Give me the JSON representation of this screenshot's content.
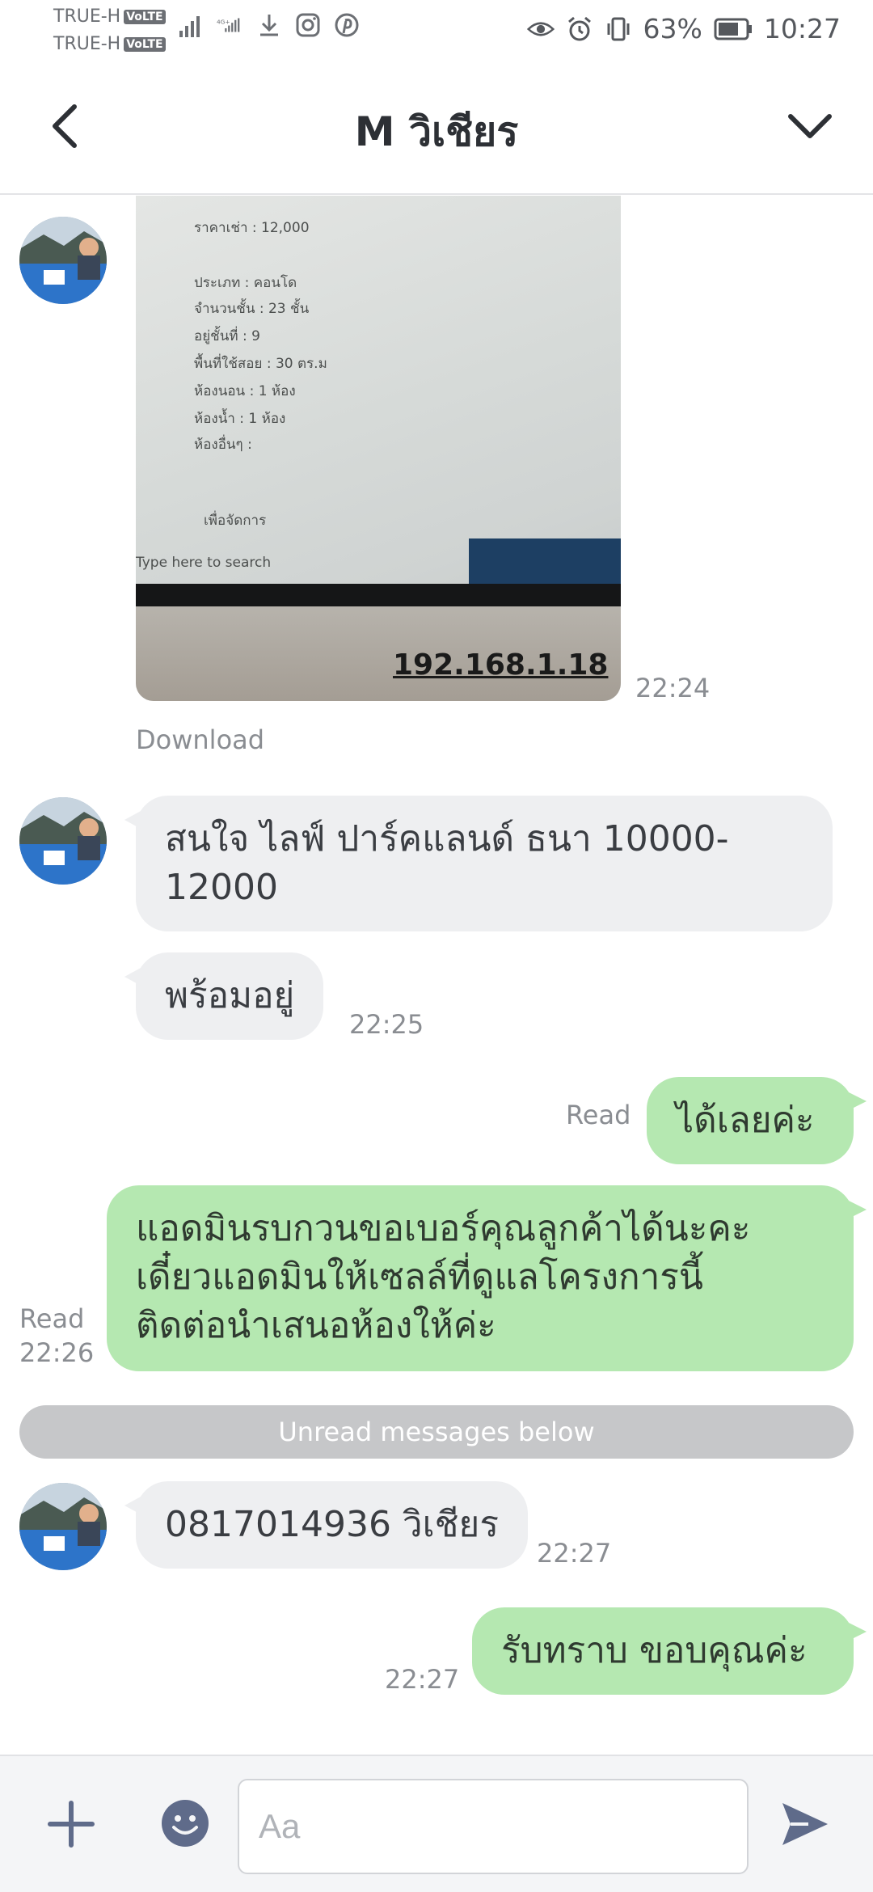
{
  "status_bar": {
    "carrier_1": "TRUE-H",
    "carrier_2": "TRUE-H",
    "volte": "VoLTE",
    "network": "4G+",
    "battery": "63%",
    "time": "10:27",
    "icons": [
      "signal-icon",
      "download-icon",
      "instagram-icon",
      "pinterest-icon",
      "eye-icon",
      "alarm-icon",
      "vibrate-icon",
      "battery-icon"
    ]
  },
  "header": {
    "title": "M วิเชียร"
  },
  "photo": {
    "lines": [
      "ราคาเช่า : 12,000",
      "ประเภท : คอนโด",
      "จำนวนชั้น : 23 ชั้น",
      "อยู่ชั้นที่ : 9",
      "พื้นที่ใช้สอย : 30 ตร.ม",
      "ห้องนอน : 1 ห้อง",
      "ห้องน้ำ : 1 ห้อง",
      "ห้องอื่นๆ :",
      "เพื่อจัดการ",
      "Type here to search"
    ],
    "ip": "192.168.1.18",
    "time": "22:24",
    "download": "Download"
  },
  "messages": {
    "m1": {
      "text": "สนใจ ไลฟ์ ปาร์คแลนด์ ธนา 10000-12000"
    },
    "m2": {
      "text": "พร้อมอยู่",
      "time": "22:25"
    },
    "m3": {
      "text": "ได้เลยค่ะ",
      "status": "Read"
    },
    "m4": {
      "text": "แอดมินรบกวนขอเบอร์คุณลูกค้าได้นะคะ เดี๋ยวแอดมินให้เซลล์ที่ดูแลโครงการนี้ ติดต่อนำเสนอห้องให้ค่ะ",
      "status": "Read",
      "time": "22:26"
    },
    "unread": "Unread messages below",
    "m5": {
      "text": "0817014936 วิเชียร",
      "time": "22:27"
    },
    "m6": {
      "text": "รับทราบ ขอบคุณค่ะ",
      "time": "22:27"
    }
  },
  "input_bar": {
    "placeholder": "Aa"
  },
  "colors": {
    "outgoing_bubble": "#b5e8b1",
    "incoming_bubble": "#eeeff1",
    "icon_color": "#5f6b8a"
  }
}
